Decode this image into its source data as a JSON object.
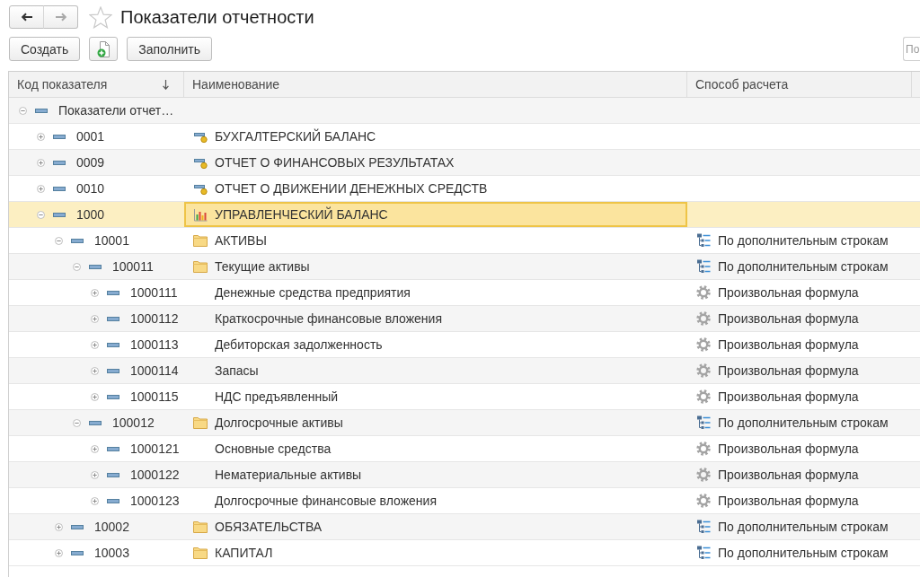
{
  "nav": {
    "back": {
      "disabled": false
    },
    "forward": {
      "disabled": true
    }
  },
  "favorite": false,
  "title": "Показатели отчетности",
  "toolbar": {
    "buttons": [
      {
        "kind": "text",
        "label": "Создать"
      },
      {
        "kind": "add-icon"
      },
      {
        "kind": "text",
        "label": "Заполнить"
      }
    ],
    "search": {
      "placeholder": "По"
    }
  },
  "table": {
    "columns": [
      {
        "label": "Код показателя",
        "sorted": true
      },
      {
        "label": "Наименование",
        "sorted": false
      },
      {
        "label": "Способ расчета",
        "sorted": false
      }
    ],
    "rows": [
      {
        "code": "Показатели отчет…",
        "expanded": true,
        "selected": false,
        "children": [
          {
            "code": "0001",
            "name": "БУХГАЛТЕРСКИЙ БАЛАНС",
            "kind": "report",
            "expanded": false,
            "selected": false
          },
          {
            "code": "0009",
            "name": "ОТЧЕТ О ФИНАНСОВЫХ РЕЗУЛЬТАТАХ",
            "kind": "report",
            "expanded": false,
            "selected": false
          },
          {
            "code": "0010",
            "name": "ОТЧЕТ О ДВИЖЕНИИ ДЕНЕЖНЫХ СРЕДСТВ",
            "kind": "report",
            "expanded": false,
            "selected": false
          },
          {
            "code": "1000",
            "name": "УПРАВЛЕНЧЕСКИЙ БАЛАНС",
            "kind": "chart",
            "expanded": true,
            "selected": true,
            "children": [
              {
                "code": "10001",
                "name": "АКТИВЫ",
                "kind": "group",
                "method": {
                  "text": "По дополнительным строкам",
                  "kind": "rows"
                },
                "expanded": true,
                "selected": false,
                "children": [
                  {
                    "code": "100011",
                    "name": "Текущие активы",
                    "kind": "group",
                    "method": {
                      "text": "По дополнительным строкам",
                      "kind": "rows"
                    },
                    "expanded": true,
                    "selected": false,
                    "children": [
                      {
                        "code": "1000111",
                        "name": "Денежные средства предприятия",
                        "kind": "item",
                        "method": {
                          "text": "Произвольная формула",
                          "kind": "formula"
                        },
                        "expanded": false,
                        "selected": false
                      },
                      {
                        "code": "1000112",
                        "name": "Краткосрочные финансовые вложения",
                        "kind": "item",
                        "method": {
                          "text": "Произвольная формула",
                          "kind": "formula"
                        },
                        "expanded": false,
                        "selected": false
                      },
                      {
                        "code": "1000113",
                        "name": "Дебиторская задолженность",
                        "kind": "item",
                        "method": {
                          "text": "Произвольная формула",
                          "kind": "formula"
                        },
                        "expanded": false,
                        "selected": false
                      },
                      {
                        "code": "1000114",
                        "name": "Запасы",
                        "kind": "item",
                        "method": {
                          "text": "Произвольная формула",
                          "kind": "formula"
                        },
                        "expanded": false,
                        "selected": false
                      },
                      {
                        "code": "1000115",
                        "name": "НДС предъявленный",
                        "kind": "item",
                        "method": {
                          "text": "Произвольная формула",
                          "kind": "formula"
                        },
                        "expanded": false,
                        "selected": false
                      }
                    ]
                  },
                  {
                    "code": "100012",
                    "name": "Долгосрочные активы",
                    "kind": "group",
                    "method": {
                      "text": "По дополнительным строкам",
                      "kind": "rows"
                    },
                    "expanded": true,
                    "selected": false,
                    "children": [
                      {
                        "code": "1000121",
                        "name": "Основные средства",
                        "kind": "item",
                        "method": {
                          "text": "Произвольная формула",
                          "kind": "formula"
                        },
                        "expanded": false,
                        "selected": false
                      },
                      {
                        "code": "1000122",
                        "name": "Нематериальные активы",
                        "kind": "item",
                        "method": {
                          "text": "Произвольная формула",
                          "kind": "formula"
                        },
                        "expanded": false,
                        "selected": false
                      },
                      {
                        "code": "1000123",
                        "name": "Долгосрочные финансовые вложения",
                        "kind": "item",
                        "method": {
                          "text": "Произвольная формула",
                          "kind": "formula"
                        },
                        "expanded": false,
                        "selected": false
                      }
                    ]
                  }
                ]
              },
              {
                "code": "10002",
                "name": "ОБЯЗАТЕЛЬСТВА",
                "kind": "group",
                "method": {
                  "text": "По дополнительным строкам",
                  "kind": "rows"
                },
                "expanded": false,
                "selected": false
              },
              {
                "code": "10003",
                "name": "КАПИТАЛ",
                "kind": "group",
                "method": {
                  "text": "По дополнительным строкам",
                  "kind": "rows"
                },
                "expanded": false,
                "selected": false
              }
            ]
          }
        ]
      }
    ]
  }
}
